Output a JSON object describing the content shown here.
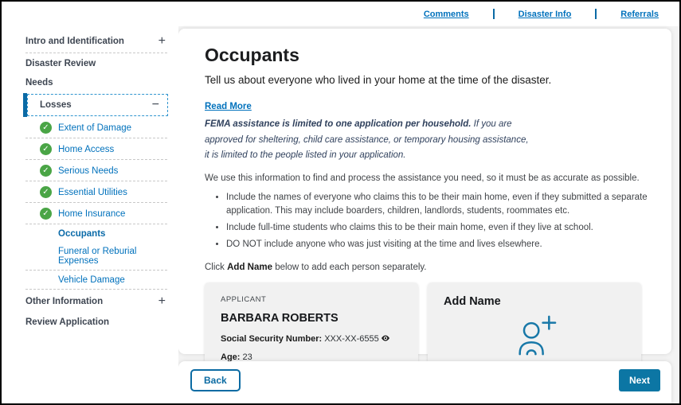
{
  "top_nav": {
    "links": [
      {
        "label": "Comments"
      },
      {
        "label": "Disaster Info"
      },
      {
        "label": "Referrals"
      }
    ]
  },
  "icons": {
    "check_glyph": "✓",
    "plus_glyph": "+",
    "minus_glyph": "−"
  },
  "sidebar": {
    "items": [
      {
        "label": "Intro and Identification"
      },
      {
        "label": "Disaster Review"
      },
      {
        "label": "Needs"
      },
      {
        "label": "Losses"
      },
      {
        "label": "Extent of Damage"
      },
      {
        "label": "Home Access"
      },
      {
        "label": "Serious Needs"
      },
      {
        "label": "Essential Utilities"
      },
      {
        "label": "Home Insurance"
      },
      {
        "label": "Occupants"
      },
      {
        "label": "Funeral or Reburial Expenses"
      },
      {
        "label": "Vehicle Damage"
      },
      {
        "label": "Other Information"
      },
      {
        "label": "Review Application"
      }
    ]
  },
  "main": {
    "title": "Occupants",
    "subtitle": "Tell us about everyone who lived in your home at the time of the disaster.",
    "read_more": "Read More",
    "fema_bold": "FEMA assistance is limited to one application per household.",
    "fema_line1_rest": "If you are",
    "fema_line2": "approved for sheltering, child care assistance, or temporary housing assistance,",
    "fema_line3": "it is limited to the people listed in your application.",
    "info": "We use this information to find and process the assistance you need, so it must be as accurate as possible.",
    "bullets": [
      "Include the names of everyone who claims this to be their main home, even if they submitted a separate application. This may include boarders, children, landlords, students, roommates etc.",
      "Include full-time students who claims this to be their main home, even if they live at school.",
      "DO NOT include anyone who was just visiting at the time and lives elsewhere."
    ],
    "click_prefix": "Click ",
    "click_bold": "Add Name",
    "click_suffix": " below to add each person separately.",
    "applicant_card": {
      "label": "APPLICANT",
      "name": "BARBARA ROBERTS",
      "ssn_label": "Social Security Number:",
      "ssn_value": "XXX-XX-6555",
      "age_label": "Age:",
      "age_value": "23"
    },
    "add_card": {
      "title": "Add Name"
    }
  },
  "footer": {
    "back": "Back",
    "next": "Next"
  },
  "colors": {
    "link_blue": "#0071bc",
    "button_blue": "#0c76a4",
    "focus_dash_blue": "#3095cf",
    "success_green": "#4aa546",
    "card_gray": "#f1f1f1"
  }
}
